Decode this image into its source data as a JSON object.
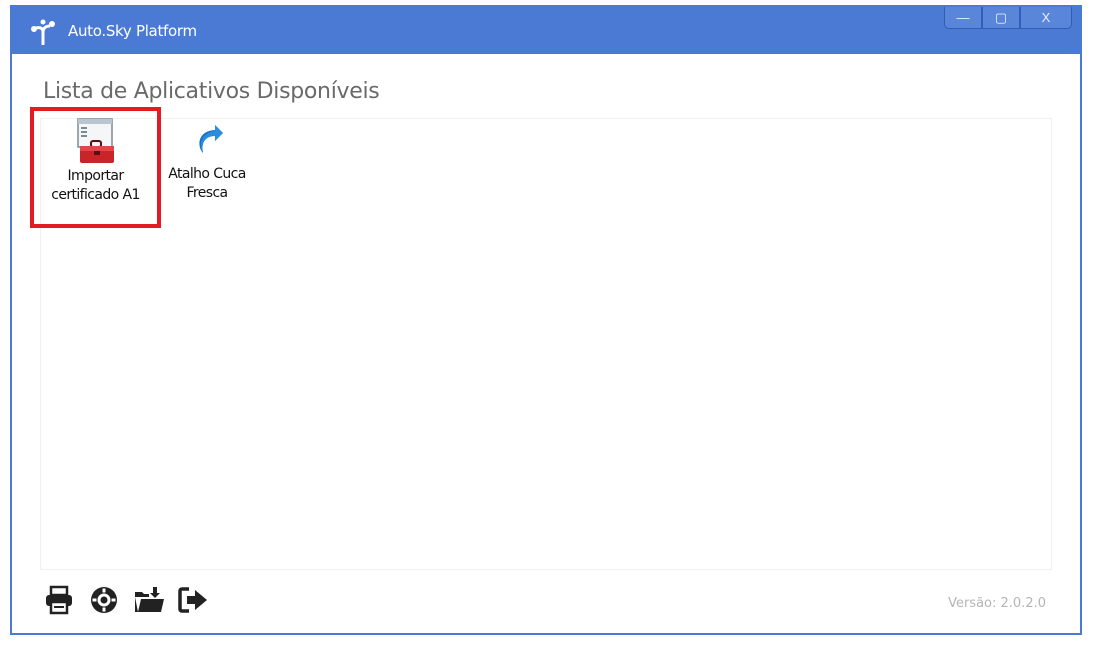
{
  "window": {
    "title": "Auto.Sky Platform",
    "controls": {
      "minimize": "—",
      "maximize": "▢",
      "close": "X"
    }
  },
  "main": {
    "heading": "Lista de Aplicativos Disponíveis",
    "apps": [
      {
        "label": "Importar\ncertificado A1",
        "icon": "toolbox-window-icon",
        "selected": true
      },
      {
        "label": "Atalho Cuca\nFresca",
        "icon": "shortcut-arrow-icon",
        "selected": false
      }
    ]
  },
  "footer": {
    "icons": [
      "printer-icon",
      "gear-icon",
      "folder-download-icon",
      "exit-icon"
    ],
    "version": "Versão: 2.0.2.0"
  },
  "colors": {
    "titlebar": "#4a7ad4",
    "selection": "#e31c24",
    "icon": "#222222"
  }
}
